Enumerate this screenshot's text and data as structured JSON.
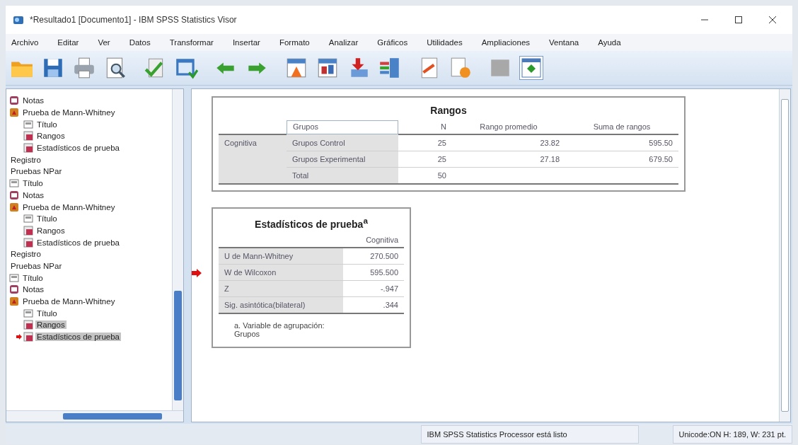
{
  "window": {
    "title": "*Resultado1 [Documento1] - IBM SPSS Statistics Visor"
  },
  "menu": [
    "Archivo",
    "Editar",
    "Ver",
    "Datos",
    "Transformar",
    "Insertar",
    "Formato",
    "Analizar",
    "Gráficos",
    "Utilidades",
    "Ampliaciones",
    "Ventana",
    "Ayuda"
  ],
  "outline": {
    "items": [
      {
        "label": "Notas",
        "kind": "notes",
        "selected": false,
        "current": false
      },
      {
        "label": "Prueba de Mann-Whitney",
        "kind": "test",
        "selected": false,
        "current": false,
        "children": [
          {
            "label": "Título",
            "kind": "title",
            "selected": false,
            "current": false
          },
          {
            "label": "Rangos",
            "kind": "table",
            "selected": false,
            "current": false
          },
          {
            "label": "Estadísticos de prueba",
            "kind": "table",
            "selected": false,
            "current": false
          }
        ]
      },
      {
        "label": "Registro",
        "kind": "log",
        "selected": false,
        "current": false
      },
      {
        "label": "Pruebas NPar",
        "kind": "heading",
        "selected": false,
        "current": false,
        "children": [
          {
            "label": "Título",
            "kind": "title",
            "selected": false,
            "current": false
          },
          {
            "label": "Notas",
            "kind": "notes",
            "selected": false,
            "current": false
          },
          {
            "label": "Prueba de Mann-Whitney",
            "kind": "test",
            "selected": false,
            "current": false,
            "children": [
              {
                "label": "Título",
                "kind": "title",
                "selected": false,
                "current": false
              },
              {
                "label": "Rangos",
                "kind": "table",
                "selected": false,
                "current": false
              },
              {
                "label": "Estadísticos de prueba",
                "kind": "table",
                "selected": false,
                "current": false
              }
            ]
          }
        ]
      },
      {
        "label": "Registro",
        "kind": "log",
        "selected": false,
        "current": false
      },
      {
        "label": "Pruebas NPar",
        "kind": "heading",
        "selected": false,
        "current": false,
        "children": [
          {
            "label": "Título",
            "kind": "title",
            "selected": false,
            "current": false
          },
          {
            "label": "Notas",
            "kind": "notes",
            "selected": false,
            "current": false
          },
          {
            "label": "Prueba de Mann-Whitney",
            "kind": "test",
            "selected": false,
            "current": false,
            "children": [
              {
                "label": "Título",
                "kind": "title",
                "selected": false,
                "current": false
              },
              {
                "label": "Rangos",
                "kind": "table",
                "selected": true,
                "current": false
              },
              {
                "label": "Estadísticos de prueba",
                "kind": "table",
                "selected": true,
                "current": true
              }
            ]
          }
        ]
      }
    ]
  },
  "ranks_table": {
    "title": "Rangos",
    "columns": [
      "Grupos",
      "N",
      "Rango promedio",
      "Suma de rangos"
    ],
    "row_label": "Cognitiva",
    "rows": [
      {
        "group": "Grupos Control",
        "n": "25",
        "mean_rank": "23.82",
        "rank_sum": "595.50"
      },
      {
        "group": "Grupos Experimental",
        "n": "25",
        "mean_rank": "27.18",
        "rank_sum": "679.50"
      },
      {
        "group": "Total",
        "n": "50"
      }
    ]
  },
  "test_table": {
    "title": "Estadísticos de prueba$^{a}$",
    "column": "Cognitiva",
    "rows": [
      {
        "label": "U de Mann-Whitney",
        "value": "270.500",
        "current": false
      },
      {
        "label": "W de Wilcoxon",
        "value": "595.500",
        "current": true
      },
      {
        "label": "Z",
        "value": "-.947",
        "current": false
      },
      {
        "label": "Sig. asintótica(bilateral)",
        "value": ".344",
        "current": false
      }
    ],
    "footnote": "a. Variable de agrupación: Grupos"
  },
  "status_bar": {
    "message": "IBM SPSS Statistics Processor está listo",
    "info": "Unicode:ON  H: 189, W: 231 pt."
  }
}
